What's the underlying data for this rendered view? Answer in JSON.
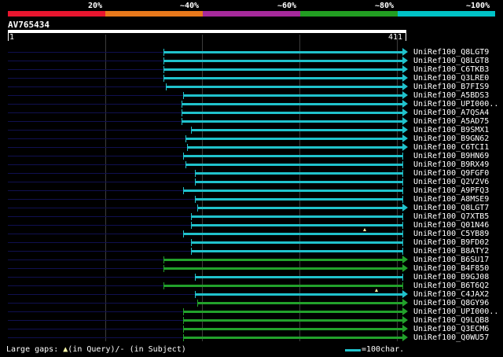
{
  "scale": {
    "segments": [
      {
        "color": "#e8162f"
      },
      {
        "color": "#e8781b"
      },
      {
        "color": "#a62a9b"
      },
      {
        "color": "#229e22"
      },
      {
        "color": "#00c2c6"
      }
    ],
    "labels": [
      "20%",
      "~40%",
      "~60%",
      "~80%",
      "~100%"
    ]
  },
  "query": {
    "id": "AV765434",
    "start": "1",
    "end": "411",
    "length": 411
  },
  "colors": {
    "background": "#000000",
    "ruler": "#ffffff",
    "gridline": "#444444",
    "unaligned_line": "#101050",
    "hit_cyan": "#20c2cc",
    "hit_green": "#22a12b",
    "gap_marker": "#ffffaa",
    "text": "#ffffff"
  },
  "hits": [
    {
      "label": "UniRef100_Q8LGT9",
      "start": 0.395,
      "color": "cyan",
      "arrow": true
    },
    {
      "label": "UniRef100_Q8LGT8",
      "start": 0.395,
      "color": "cyan",
      "arrow": true
    },
    {
      "label": "UniRef100_C6TKB3",
      "start": 0.395,
      "color": "cyan",
      "arrow": true
    },
    {
      "label": "UniRef100_Q3LRE0",
      "start": 0.395,
      "color": "cyan",
      "arrow": true
    },
    {
      "label": "UniRef100_B7FIS9",
      "start": 0.4,
      "color": "cyan",
      "arrow": true
    },
    {
      "label": "UniRef100_A5BDS3",
      "start": 0.445,
      "color": "cyan",
      "arrow": true
    },
    {
      "label": "UniRef100_UPI000..",
      "start": 0.44,
      "color": "cyan",
      "arrow": true
    },
    {
      "label": "UniRef100_A7QSA4",
      "start": 0.44,
      "color": "cyan",
      "arrow": true
    },
    {
      "label": "UniRef100_A5AD75",
      "start": 0.44,
      "color": "cyan",
      "arrow": true
    },
    {
      "label": "UniRef100_B9SMX1",
      "start": 0.465,
      "color": "cyan",
      "arrow": true
    },
    {
      "label": "UniRef100_B9GN62",
      "start": 0.45,
      "color": "cyan",
      "arrow": true
    },
    {
      "label": "UniRef100_C6TCI1",
      "start": 0.455,
      "color": "cyan",
      "arrow": true
    },
    {
      "label": "UniRef100_B9HN69",
      "start": 0.445,
      "color": "cyan",
      "arrow": false
    },
    {
      "label": "UniRef100_B9RX49",
      "start": 0.45,
      "color": "cyan",
      "arrow": false
    },
    {
      "label": "UniRef100_Q9FGF0",
      "start": 0.475,
      "color": "cyan",
      "arrow": false
    },
    {
      "label": "UniRef100_Q2V2V6",
      "start": 0.475,
      "color": "cyan",
      "arrow": false
    },
    {
      "label": "UniRef100_A9PFQ3",
      "start": 0.445,
      "color": "cyan",
      "arrow": false
    },
    {
      "label": "UniRef100_A8MSE9",
      "start": 0.475,
      "color": "cyan",
      "arrow": false
    },
    {
      "label": "UniRef100_Q8LGT7",
      "start": 0.48,
      "color": "cyan",
      "arrow": true
    },
    {
      "label": "UniRef100_Q7XTB5",
      "start": 0.465,
      "color": "cyan",
      "arrow": false
    },
    {
      "label": "UniRef100_Q01N46",
      "start": 0.465,
      "color": "cyan",
      "arrow": false
    },
    {
      "label": "UniRef100_C5YB89",
      "start": 0.445,
      "color": "cyan",
      "arrow": false,
      "gap_at": 0.905
    },
    {
      "label": "UniRef100_B9FD02",
      "start": 0.465,
      "color": "cyan",
      "arrow": false
    },
    {
      "label": "UniRef100_B8ATY2",
      "start": 0.465,
      "color": "cyan",
      "arrow": false
    },
    {
      "label": "UniRef100_B6SU17",
      "start": 0.395,
      "color": "green",
      "arrow": true
    },
    {
      "label": "UniRef100_B4F850",
      "start": 0.395,
      "color": "green",
      "arrow": true
    },
    {
      "label": "UniRef100_B9GJ08",
      "start": 0.475,
      "color": "cyan",
      "arrow": false
    },
    {
      "label": "UniRef100_B6T6Q2",
      "start": 0.395,
      "color": "green",
      "arrow": false
    },
    {
      "label": "UniRef100_C4JAX2",
      "start": 0.475,
      "color": "cyan",
      "arrow": true,
      "gap_at": 0.935
    },
    {
      "label": "UniRef100_Q8GY96",
      "start": 0.48,
      "color": "green",
      "arrow": true
    },
    {
      "label": "UniRef100_UPI000..",
      "start": 0.445,
      "color": "green",
      "arrow": true
    },
    {
      "label": "UniRef100_Q9LQB8",
      "start": 0.445,
      "color": "green",
      "arrow": true
    },
    {
      "label": "UniRef100_Q3ECM6",
      "start": 0.445,
      "color": "green",
      "arrow": true
    },
    {
      "label": "UniRef100_Q0WU57",
      "start": 0.445,
      "color": "green",
      "arrow": true
    }
  ],
  "footer": {
    "gaps_label": "Large gaps:",
    "gaps_query": "(in Query)/",
    "gaps_subject": "- (in Subject)",
    "legend_text": "=100char."
  }
}
